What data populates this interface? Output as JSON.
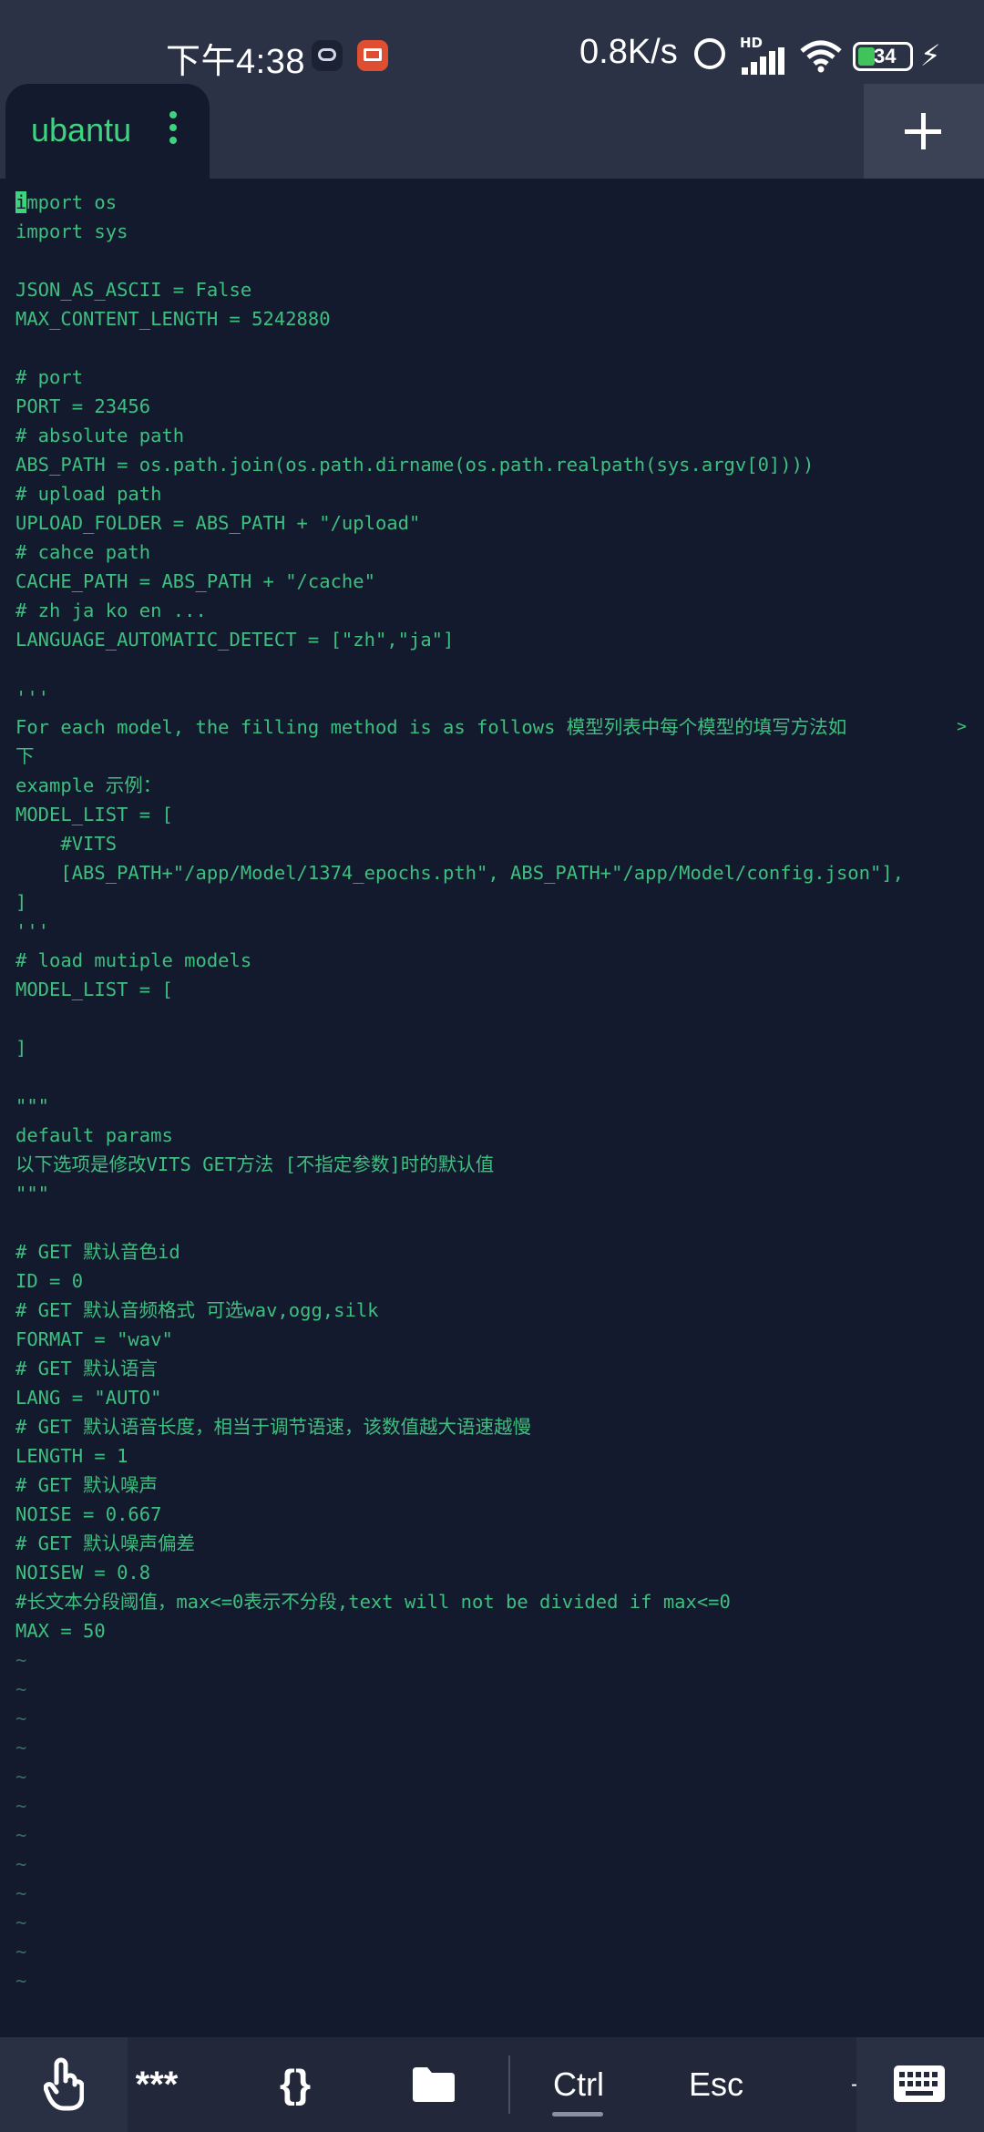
{
  "status_bar": {
    "time": "下午4:38",
    "net_speed": "0.8K/s",
    "network_badge": "HD",
    "battery": "34",
    "icons": [
      "cloud-app-icon",
      "cast-app-icon",
      "alarm-icon",
      "signal-icon",
      "wifi-icon",
      "battery-icon",
      "charging-icon"
    ]
  },
  "tabs": [
    {
      "label": "ubantu"
    }
  ],
  "colors": {
    "accent": "#3fd27f",
    "background": "#141a2e",
    "chrome": "#2c3246",
    "text": "#3fbf7f"
  },
  "editor": {
    "cursor_char": "i",
    "lines": [
      "mport os",
      "import sys",
      "",
      "JSON_AS_ASCII = False",
      "MAX_CONTENT_LENGTH = 5242880",
      "",
      "# port",
      "PORT = 23456",
      "# absolute path",
      "ABS_PATH = os.path.join(os.path.dirname(os.path.realpath(sys.argv[0])))",
      "# upload path",
      "UPLOAD_FOLDER = ABS_PATH + \"/upload\"",
      "# cahce path",
      "CACHE_PATH = ABS_PATH + \"/cache\"",
      "# zh ja ko en ...",
      "LANGUAGE_AUTOMATIC_DETECT = [\"zh\",\"ja\"]",
      "",
      "'''",
      "For each model, the filling method is as follows 模型列表中每个模型的填写方法如",
      "下",
      "example 示例：",
      "MODEL_LIST = [",
      "    #VITS",
      "    [ABS_PATH+\"/app/Model/1374_epochs.pth\", ABS_PATH+\"/app/Model/config.json\"],",
      "]",
      "'''",
      "# load mutiple models",
      "MODEL_LIST = [",
      "",
      "]",
      "",
      "\"\"\"",
      "default params",
      "以下选项是修改VITS GET方法 [不指定参数]时的默认值",
      "\"\"\"",
      "",
      "# GET 默认音色id",
      "ID = 0",
      "# GET 默认音频格式 可选wav,ogg,silk",
      "FORMAT = \"wav\"",
      "# GET 默认语言",
      "LANG = \"AUTO\"",
      "# GET 默认语音长度，相当于调节语速，该数值越大语速越慢",
      "LENGTH = 1",
      "# GET 默认噪声",
      "NOISE = 0.667",
      "# GET 默认噪声偏差",
      "NOISEW = 0.8",
      "#长文本分段阈值，max<=0表示不分段,text will not be divided if max<=0",
      "MAX = 50",
      "~",
      "~",
      "~",
      "~",
      "~",
      "~",
      "~",
      "~",
      "~",
      "~",
      "~",
      "~"
    ],
    "continuation_marker": ">"
  },
  "toolbar": {
    "stars_label": "***",
    "braces_label": "{}",
    "ctrl_label": "Ctrl",
    "esc_label": "Esc",
    "dash_label": "-"
  }
}
